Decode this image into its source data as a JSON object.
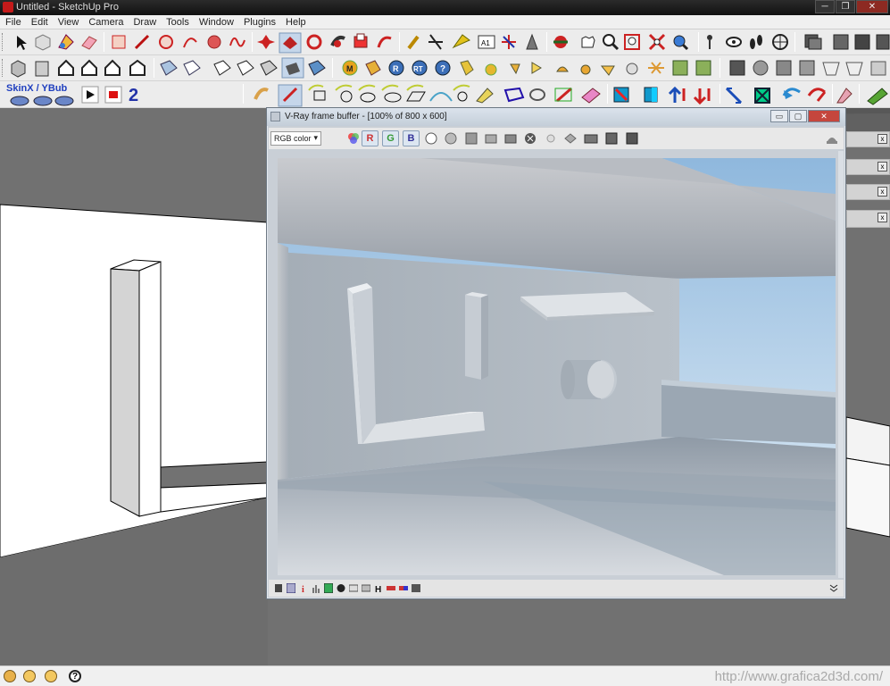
{
  "window": {
    "title": "Untitled - SketchUp Pro"
  },
  "menu": [
    "File",
    "Edit",
    "View",
    "Camera",
    "Draw",
    "Tools",
    "Window",
    "Plugins",
    "Help"
  ],
  "toolbar": {
    "skinx_label": "SkinX / YBub"
  },
  "vfb": {
    "title": "V-Ray frame buffer - [100% of 800 x 600]",
    "channel_select": "RGB color",
    "channels": [
      "R",
      "G",
      "B"
    ]
  },
  "status": {
    "watermark": "http://www.grafica2d3d.com/"
  },
  "colors": {
    "accent_red": "#c41a1a",
    "vfb_title_bg": "#dbe3ec",
    "viewport_gray": "#717171"
  }
}
